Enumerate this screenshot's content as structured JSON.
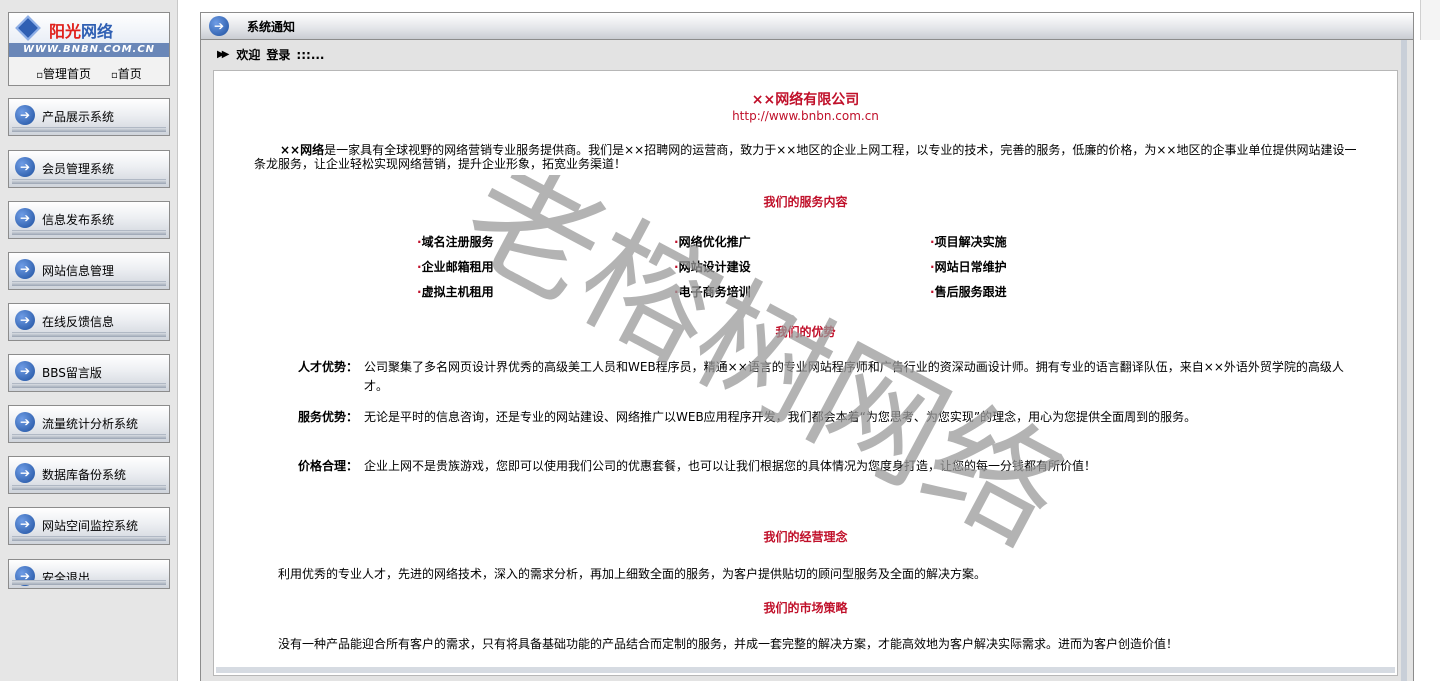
{
  "logo": {
    "name_part1": "阳光",
    "name_part2": "网络",
    "url": "WWW.BNBN.COM.CN",
    "links": [
      "管理首页",
      "首页"
    ]
  },
  "sidebar": {
    "items": [
      {
        "label": "产品展示系统"
      },
      {
        "label": "会员管理系统"
      },
      {
        "label": "信息发布系统"
      },
      {
        "label": "网站信息管理"
      },
      {
        "label": "在线反馈信息"
      },
      {
        "label": "BBS留言版"
      },
      {
        "label": "流量统计分析系统"
      },
      {
        "label": "数据库备份系统"
      },
      {
        "label": "网站空间监控系统"
      },
      {
        "label": "安全退出"
      }
    ]
  },
  "header": {
    "title": "系统通知"
  },
  "welcome": {
    "text1": "欢迎",
    "text2": "登录",
    "text3": ":::..."
  },
  "content": {
    "company_name": "××网络有限公司",
    "company_url": "http://www.bnbn.com.cn",
    "intro_bold": "××网络",
    "intro_text": "是一家具有全球视野的网络营销专业服务提供商。我们是××招聘网的运营商，致力于××地区的企业上网工程，以专业的技术，完善的服务，低廉的价格，为××地区的企事业单位提供网站建设一条龙服务，让企业轻松实现网络营销，提升企业形象，拓宽业务渠道！",
    "services_title": "我们的服务内容",
    "services": [
      "域名注册服务",
      "网络优化推广",
      "项目解决实施",
      "企业邮箱租用",
      "网站设计建设",
      "网站日常维护",
      "虚拟主机租用",
      "电子商务培训",
      "售后服务跟进"
    ],
    "advantages_title": "我们的优势",
    "advantages": [
      {
        "label": "人才优势：",
        "text": "公司聚集了多名网页设计界优秀的高级美工人员和WEB程序员，精通××语言的专业网站程序师和广告行业的资深动画设计师。拥有专业的语言翻译队伍，来自××外语外贸学院的高级人才。"
      },
      {
        "label": "服务优势：",
        "text": "无论是平时的信息咨询，还是专业的网站建设、网络推广以WEB应用程序开发，我们都会本着“为您思考、为您实现”的理念，用心为您提供全面周到的服务。"
      },
      {
        "label": "价格合理：",
        "text": "企业上网不是贵族游戏，您即可以使用我们公司的优惠套餐，也可以让我们根据您的具体情况为您度身打造，让您的每一分钱都有所价值！"
      }
    ],
    "philosophy_title": "我们的经营理念",
    "philosophy_text": "利用优秀的专业人才，先进的网络技术，深入的需求分析，再加上细致全面的服务，为客户提供贴切的顾问型服务及全面的解决方案。",
    "strategy_title": "我们的市场策略",
    "strategy_text": "没有一种产品能迎合所有客户的需求，只有将具备基础功能的产品结合而定制的服务，并成一套完整的解决方案，才能高效地为客户解决实际需求。进而为客户创造价值！",
    "watermark": "老榕树网络"
  }
}
